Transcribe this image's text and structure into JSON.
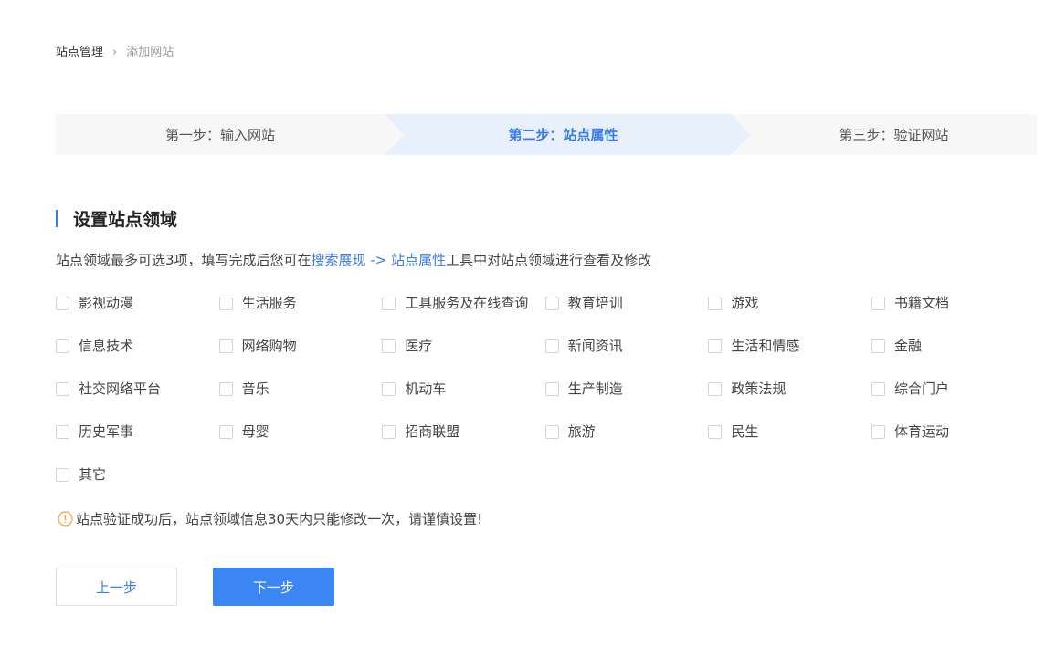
{
  "breadcrumb": {
    "parent": "站点管理",
    "separator": "›",
    "current": "添加网站"
  },
  "steps": [
    {
      "label": "第一步：输入网站",
      "state": "done"
    },
    {
      "label": "第二步：站点属性",
      "state": "active"
    },
    {
      "label": "第三步：验证网站",
      "state": "pending"
    }
  ],
  "section": {
    "title": "设置站点领域",
    "desc_prefix": "站点领域最多可选3项，填写完成后您可在",
    "desc_link": "搜索展现 -> 站点属性",
    "desc_suffix": "工具中对站点领域进行查看及修改"
  },
  "categories": [
    [
      "影视动漫",
      "生活服务",
      "工具服务及在线查询",
      "教育培训",
      "游戏",
      "书籍文档"
    ],
    [
      "信息技术",
      "网络购物",
      "医疗",
      "新闻资讯",
      "生活和情感",
      "金融"
    ],
    [
      "社交网络平台",
      "音乐",
      "机动车",
      "生产制造",
      "政策法规",
      "综合门户"
    ],
    [
      "历史军事",
      "母婴",
      "招商联盟",
      "旅游",
      "民生",
      "体育运动"
    ],
    [
      "其它"
    ]
  ],
  "notice": {
    "text": "站点验证成功后，站点领域信息30天内只能修改一次，请谨慎设置!",
    "icon": "warning-circle-icon"
  },
  "buttons": {
    "prev": "上一步",
    "next": "下一步"
  },
  "colors": {
    "accent": "#3b7bea",
    "primary_button": "#3b86f4",
    "active_step_bg": "#e8f0fc",
    "inactive_step_bg": "#f7f7f8",
    "warning": "#f5a142"
  }
}
